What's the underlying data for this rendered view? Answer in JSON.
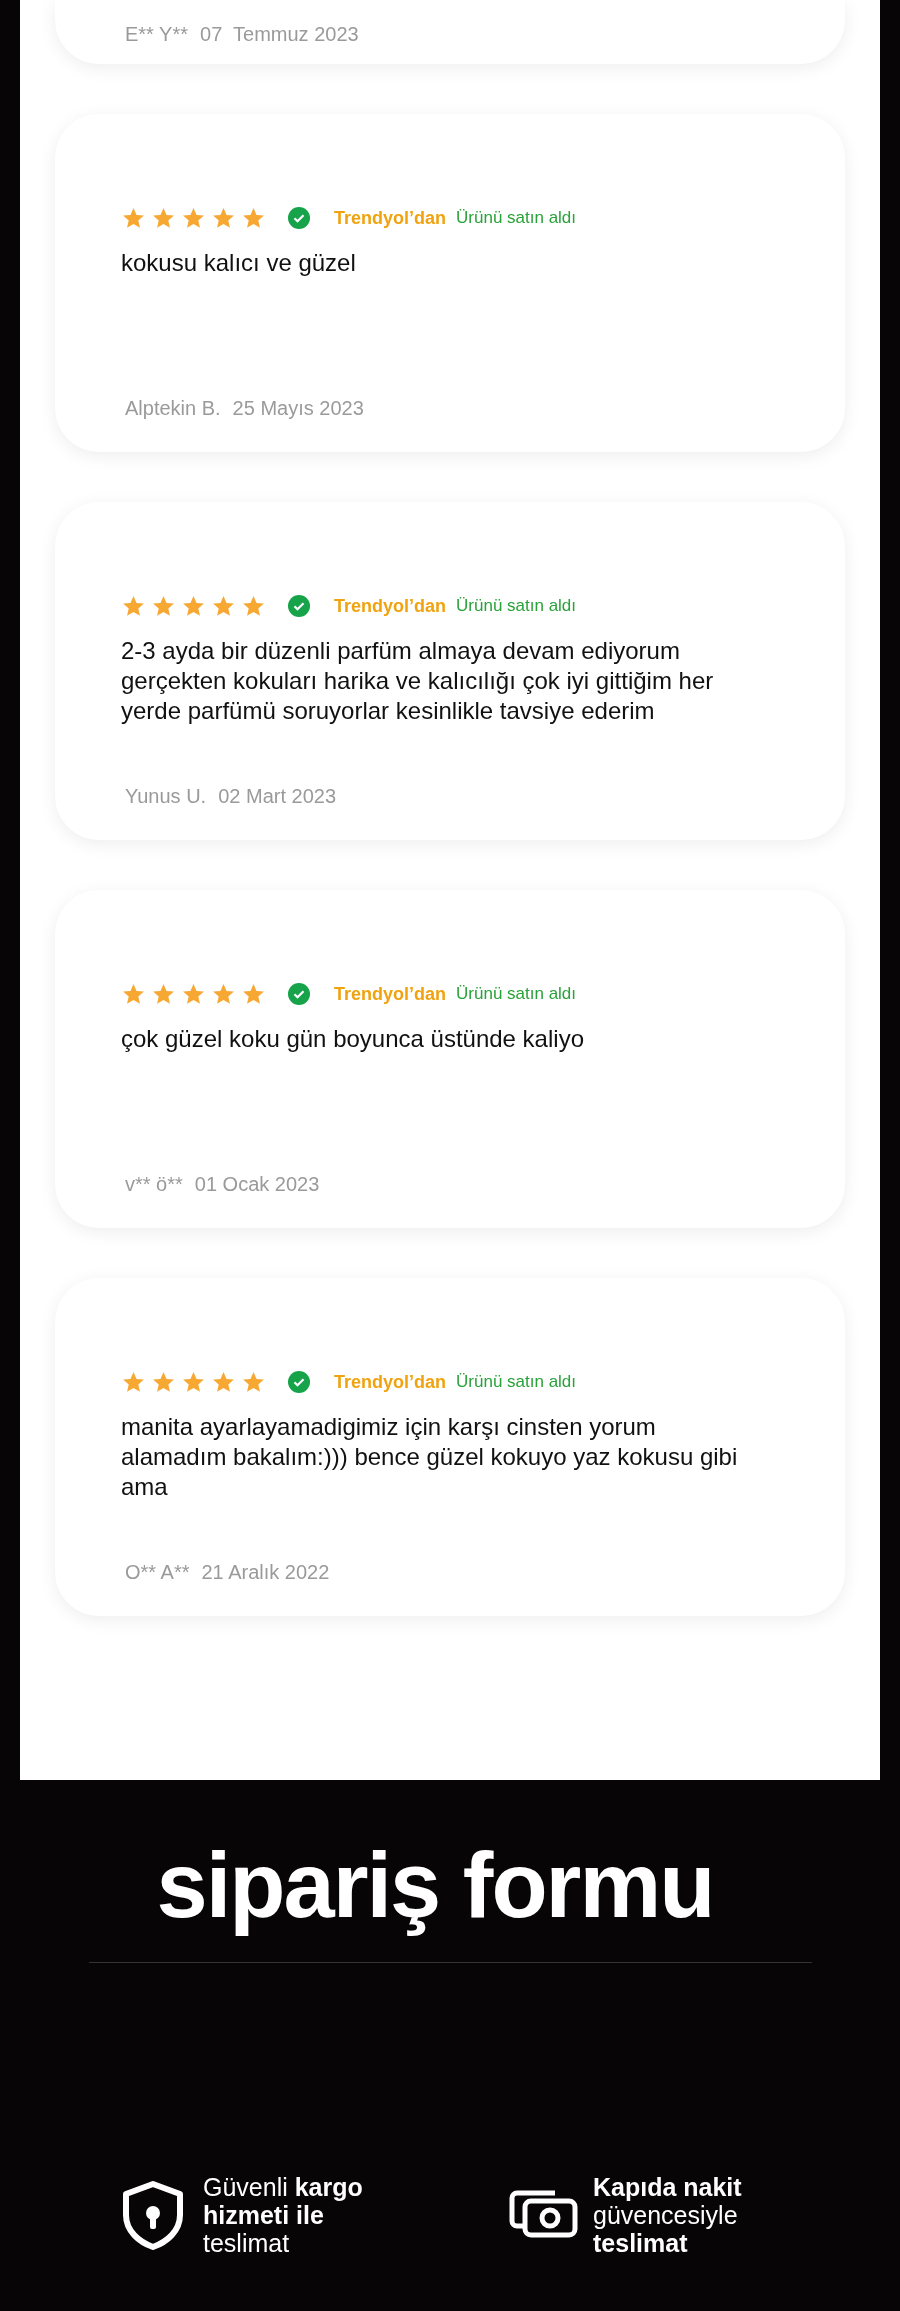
{
  "partial_review": {
    "author": "E** Y**",
    "date": "07  Temmuz 2023"
  },
  "reviews": [
    {
      "stars": 5,
      "verified": true,
      "seller": "Trendyol’dan",
      "purchase": "Ürünü satın aldı",
      "text": "kokusu kalıcı ve güzel",
      "author": "Alptekin B.",
      "date": "25 Mayıs 2023"
    },
    {
      "stars": 5,
      "verified": true,
      "seller": "Trendyol’dan",
      "purchase": "Ürünü satın aldı",
      "text": "2-3 ayda bir düzenli parfüm almaya devam ediyorum gerçekten kokuları harika ve kalıcılığı çok iyi gittiğim her yerde parfümü soruyorlar kesinlikle tavsiye ederim",
      "author": "Yunus U.",
      "date": "02 Mart 2023"
    },
    {
      "stars": 5,
      "verified": true,
      "seller": "Trendyol’dan",
      "purchase": "Ürünü satın aldı",
      "text": "çok güzel koku gün boyunca üstünde kaliyo",
      "author": "v** ö**",
      "date": "01 Ocak 2023"
    },
    {
      "stars": 5,
      "verified": true,
      "seller": "Trendyol’dan",
      "purchase": "Ürünü satın aldı",
      "text": "manita ayarlayamadigimiz için karşı cinsten yorum alamadım bakalım:))) bence güzel kokuyo yaz kokusu gibi ama",
      "author": "O** A**",
      "date": "21 Aralık 2022"
    }
  ],
  "order_form": {
    "title": "sipariş formu"
  },
  "features": [
    {
      "kind": "shield",
      "text": "Güvenli **kargo hizmeti ile** teslimat"
    },
    {
      "kind": "cash",
      "text": "**Kapıda nakit** güvencesiyle **teslimat**"
    }
  ]
}
